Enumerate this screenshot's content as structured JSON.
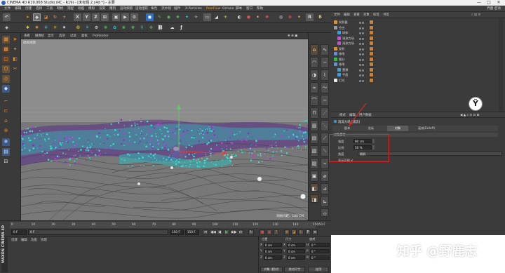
{
  "window": {
    "title": "CINEMA 4D R19.068 Studio (RC - R19) - [未标题 2.c4d *] - 主要",
    "controls": [
      "—",
      "□",
      "✕"
    ]
  },
  "menubar": {
    "items": [
      "文件",
      "编辑",
      "创建",
      "选择",
      "工具",
      "网格",
      "捕捉",
      "动画",
      "模拟",
      "渲染",
      "雕刻",
      "运动跟踪",
      "运动图形",
      "角色",
      "流水线",
      "插件",
      "X-Particles",
      "RealFlow",
      "Octane",
      "脚本",
      "窗口",
      "帮助"
    ],
    "highlighted": [
      "X-Particles",
      "RealFlow"
    ],
    "right_items": [
      "界面",
      "启动"
    ]
  },
  "viewport": {
    "menu": [
      "查看",
      "摄像机",
      "显示",
      "选项",
      "过滤",
      "面板",
      "ProRender"
    ],
    "label": "透视视图",
    "grid_info": "网格间距：100 CM"
  },
  "object_manager": {
    "menu": [
      "文件",
      "编辑",
      "查看",
      "对象",
      "标签",
      "书签"
    ],
    "rows": [
      {
        "name": "发射器",
        "indent": 0,
        "color": "#e0902a"
      },
      {
        "name": "空白",
        "indent": 0,
        "color": "#9a9a9a"
      },
      {
        "name": "球体",
        "indent": 1,
        "color": "#3aa0e0"
      },
      {
        "name": "湍流力场",
        "indent": 1,
        "color": "#c84fd8"
      },
      {
        "name": "湍流力场",
        "indent": 1,
        "color": "#c84fd8"
      },
      {
        "name": "发射",
        "indent": 0,
        "color": "#e0902a"
      },
      {
        "name": "修改",
        "indent": 0,
        "color": "#6a8fd0"
      },
      {
        "name": "细分",
        "indent": 0,
        "color": "#39b54a"
      },
      {
        "name": "修改",
        "indent": 0,
        "color": "#6a8fd0"
      },
      {
        "name": "置换",
        "indent": 1,
        "color": "#3aa0e0"
      },
      {
        "name": "平面",
        "indent": 1,
        "color": "#3aa0e0"
      },
      {
        "name": "灯光",
        "indent": 0,
        "color": "#e8e8e8"
      }
    ],
    "logo_icon": "deer-logo-icon"
  },
  "attribute_manager": {
    "menu": [
      "模式",
      "编辑",
      "用户数据"
    ],
    "object_title": "湍流力场 [湍流]",
    "tabs": [
      "基本",
      "坐标",
      "对象",
      "衰减(Falloff)"
    ],
    "active_tab": "对象",
    "section": "对象属性",
    "fields": [
      {
        "label": "强度",
        "value": "80 cm"
      },
      {
        "label": "比例",
        "value": "50 %"
      }
    ],
    "dropdown_label": "角度",
    "dropdown_value": "随机",
    "checkbox_label": "显示可视 ✔"
  },
  "timeline": {
    "ticks": [
      "0",
      "10",
      "20",
      "30",
      "40",
      "50",
      "60",
      "70",
      "80",
      "90",
      "100",
      "110",
      "120",
      "130",
      "140",
      "150"
    ],
    "current_frame": "0 F",
    "start": "0 F",
    "end": "150 F",
    "end2": "150 F",
    "right_frame": "150 F",
    "buttons": [
      "⏮",
      "◀◀",
      "◀",
      "▶",
      "▶▶",
      "⏭"
    ]
  },
  "material_manager": {
    "menu": [
      "创建",
      "编辑",
      "功能",
      "纹理"
    ],
    "brand": "MAXON CINEMA 4D"
  },
  "coordinates": {
    "headers": [
      "位置",
      "尺寸",
      "旋转"
    ],
    "rows": [
      {
        "axis": "X",
        "pos": "0 cm",
        "size": "0 cm",
        "rot_axis": "H",
        "rot": "0 °"
      },
      {
        "axis": "Y",
        "pos": "0 cm",
        "size": "0 cm",
        "rot_axis": "P",
        "rot": "0 °"
      },
      {
        "axis": "Z",
        "pos": "0 cm",
        "size": "0 cm",
        "rot_axis": "B",
        "rot": "0 °"
      }
    ],
    "mode": "对象 (相对)",
    "size_mode": "绝对尺寸",
    "apply": "应用"
  },
  "watermark": "知乎 @野鹿志",
  "colors": {
    "accent_orange": "#e08a20",
    "highlight_red": "#d42a2a",
    "particle_cyan": "#3fd8d0",
    "particle_purple": "#8a2fc8"
  }
}
